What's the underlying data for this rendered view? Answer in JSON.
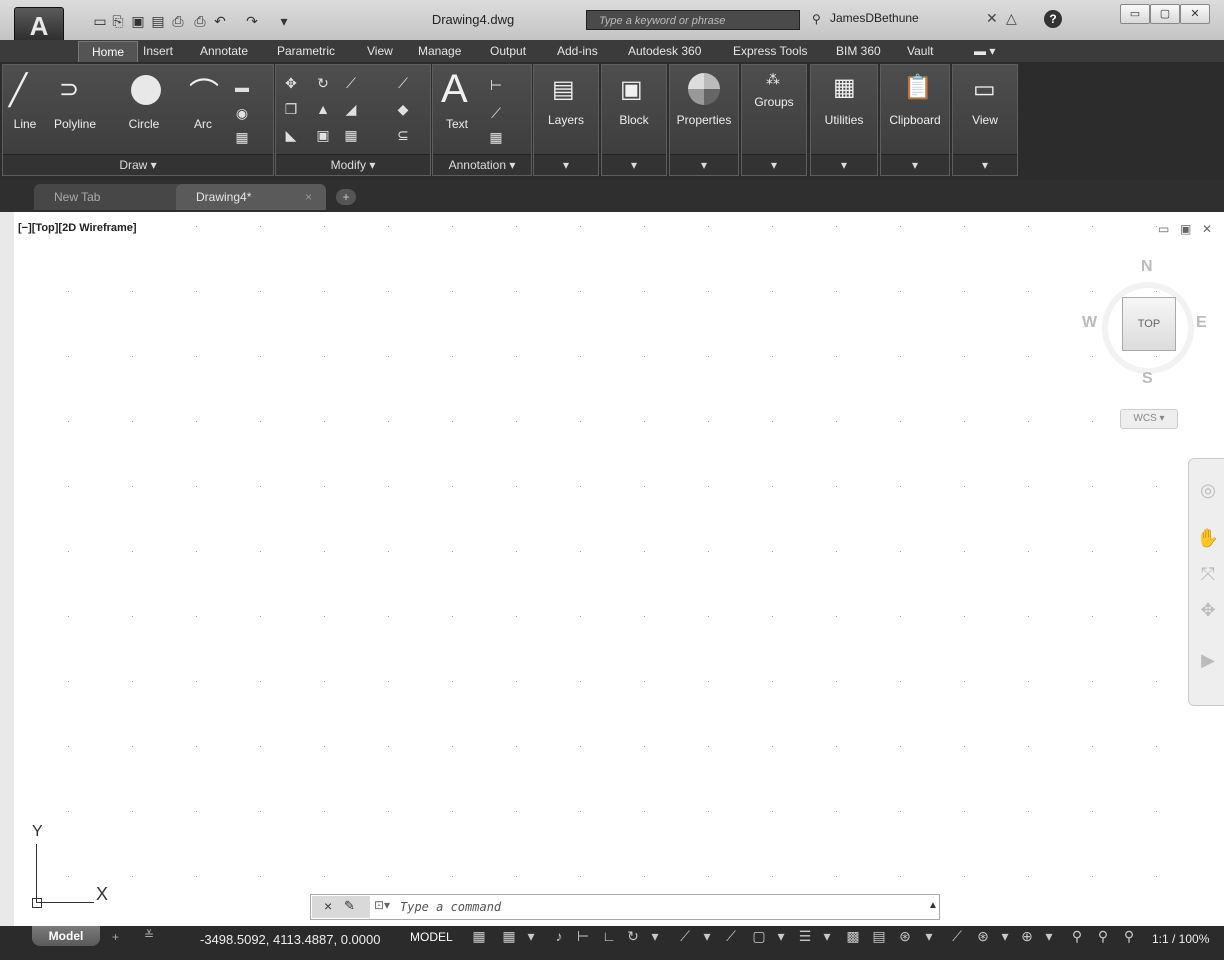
{
  "app": {
    "logo_letter": "A",
    "document_title": "Drawing4.dwg"
  },
  "search": {
    "placeholder": "Type a keyword or phrase"
  },
  "user": {
    "name": "JamesDBethune"
  },
  "ribbon_tabs": [
    "Home",
    "Insert",
    "Annotate",
    "Parametric",
    "View",
    "Manage",
    "Output",
    "Add-ins",
    "Autodesk 360",
    "Express Tools",
    "BIM 360",
    "Vault"
  ],
  "panels": {
    "draw": {
      "title": "Draw",
      "tools": [
        "Line",
        "Polyline",
        "Circle",
        "Arc"
      ]
    },
    "modify": {
      "title": "Modify"
    },
    "annotation": {
      "title": "Annotation",
      "text_label": "Text"
    },
    "layers": "Layers",
    "block": "Block",
    "properties": "Properties",
    "groups": "Groups",
    "utilities": "Utilities",
    "clipboard": "Clipboard",
    "view": "View"
  },
  "doc_tabs": {
    "new_tab": "New Tab",
    "drawing": "Drawing4*"
  },
  "viewport": {
    "label": "[−][Top][2D Wireframe]"
  },
  "viewcube": {
    "top": "TOP",
    "north": "N",
    "south": "S",
    "east": "E",
    "west": "W",
    "wcs": "WCS"
  },
  "ucs": {
    "x": "X",
    "y": "Y"
  },
  "command": {
    "placeholder": "Type a command"
  },
  "status": {
    "model_tab": "Model",
    "coordinates": "-3498.5092, 4113.4887, 0.0000",
    "mode": "MODEL",
    "scale": "1:1 / 100%"
  },
  "icons": {
    "close": "×",
    "wrench": "🔧",
    "help": "?",
    "minimize": "–",
    "maximize": "□",
    "exit": "✖"
  }
}
